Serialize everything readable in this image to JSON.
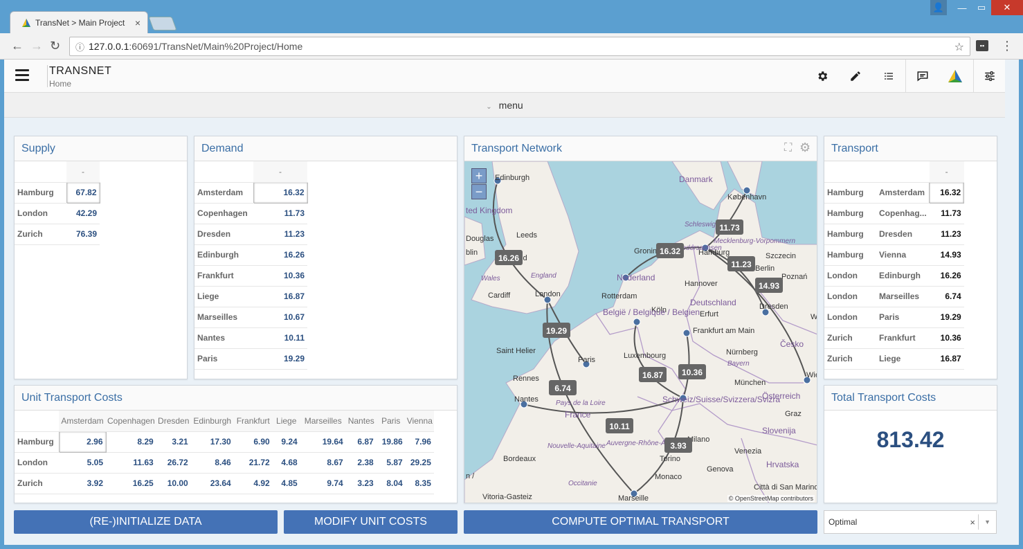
{
  "browser": {
    "tab_title": "TransNet > Main Project",
    "url_host": "127.0.0.1",
    "url_path": ":60691/TransNet/Main%20Project/Home"
  },
  "header": {
    "title": "TRANSNET",
    "subtitle": "Home",
    "icons": [
      "gear-icon",
      "pencil-icon",
      "list-icon",
      "chat-icon",
      "logo-icon",
      "sliders-icon"
    ]
  },
  "menu": {
    "label": "menu"
  },
  "supply": {
    "title": "Supply",
    "col_header": "-",
    "rows": [
      {
        "name": "Hamburg",
        "value": "67.82"
      },
      {
        "name": "London",
        "value": "42.29"
      },
      {
        "name": "Zurich",
        "value": "76.39"
      }
    ]
  },
  "demand": {
    "title": "Demand",
    "col_header": "-",
    "rows": [
      {
        "name": "Amsterdam",
        "value": "16.32"
      },
      {
        "name": "Copenhagen",
        "value": "11.73"
      },
      {
        "name": "Dresden",
        "value": "11.23"
      },
      {
        "name": "Edinburgh",
        "value": "16.26"
      },
      {
        "name": "Frankfurt",
        "value": "10.36"
      },
      {
        "name": "Liege",
        "value": "16.87"
      },
      {
        "name": "Marseilles",
        "value": "10.67"
      },
      {
        "name": "Nantes",
        "value": "10.11"
      },
      {
        "name": "Paris",
        "value": "19.29"
      }
    ]
  },
  "network": {
    "title": "Transport Network",
    "zoom_in": "+",
    "zoom_out": "−",
    "attribution": "© OpenStreetMap contributors",
    "place_labels": [
      {
        "text": "Danmark",
        "cls": "country"
      },
      {
        "text": "København",
        "cls": "city"
      },
      {
        "text": "Edinburgh",
        "cls": "city"
      },
      {
        "text": "ted Kingdom",
        "cls": "country"
      },
      {
        "text": "Leeds",
        "cls": "city"
      },
      {
        "text": "Douglas",
        "cls": "city"
      },
      {
        "text": "blin",
        "cls": "city"
      },
      {
        "text": "Sheffield",
        "cls": "city"
      },
      {
        "text": "England",
        "cls": "region"
      },
      {
        "text": "Wales",
        "cls": "region"
      },
      {
        "text": "Cardiff",
        "cls": "city"
      },
      {
        "text": "London",
        "cls": "city"
      },
      {
        "text": "Rotterdam",
        "cls": "city"
      },
      {
        "text": "Nederland",
        "cls": "country"
      },
      {
        "text": "Groningen",
        "cls": "city"
      },
      {
        "text": "Hamburg",
        "cls": "city"
      },
      {
        "text": "Schleswig-Holstein",
        "cls": "region"
      },
      {
        "text": "Mecklenburg-Vorpommern",
        "cls": "region"
      },
      {
        "text": "Szczecin",
        "cls": "city"
      },
      {
        "text": "Niedersachsen",
        "cls": "region"
      },
      {
        "text": "Berlin",
        "cls": "city"
      },
      {
        "text": "Hannover",
        "cls": "city"
      },
      {
        "text": "Poznań",
        "cls": "city"
      },
      {
        "text": "Deutschland",
        "cls": "country"
      },
      {
        "text": "Köln",
        "cls": "city"
      },
      {
        "text": "België / Belgique / Belgien",
        "cls": "country"
      },
      {
        "text": "Erfurt",
        "cls": "city"
      },
      {
        "text": "Dresden",
        "cls": "city"
      },
      {
        "text": "Wro",
        "cls": "city"
      },
      {
        "text": "Frankfurt am Main",
        "cls": "city"
      },
      {
        "text": "Česko",
        "cls": "country"
      },
      {
        "text": "Saint Helier",
        "cls": "city"
      },
      {
        "text": "Paris",
        "cls": "city"
      },
      {
        "text": "Luxembourg",
        "cls": "city"
      },
      {
        "text": "Nürnberg",
        "cls": "city"
      },
      {
        "text": "Bayern",
        "cls": "region"
      },
      {
        "text": "Rennes",
        "cls": "city"
      },
      {
        "text": "München",
        "cls": "city"
      },
      {
        "text": "Wien",
        "cls": "city"
      },
      {
        "text": "Nantes",
        "cls": "city"
      },
      {
        "text": "Pays de la Loire",
        "cls": "region"
      },
      {
        "text": "France",
        "cls": "country"
      },
      {
        "text": "Schweiz/Suisse/Svizzera/Svizra",
        "cls": "country"
      },
      {
        "text": "Österreich",
        "cls": "country"
      },
      {
        "text": "Graz",
        "cls": "city"
      },
      {
        "text": "Nouvelle-Aquitaine",
        "cls": "region"
      },
      {
        "text": "Auvergne-Rhône-Alpes",
        "cls": "region"
      },
      {
        "text": "Milano",
        "cls": "city"
      },
      {
        "text": "Slovenija",
        "cls": "country"
      },
      {
        "text": "Bordeaux",
        "cls": "city"
      },
      {
        "text": "Venezia",
        "cls": "city"
      },
      {
        "text": "Hrvatska",
        "cls": "country"
      },
      {
        "text": "Torino",
        "cls": "city"
      },
      {
        "text": "Genova",
        "cls": "city"
      },
      {
        "text": "Monaco",
        "cls": "city"
      },
      {
        "text": "Occitanie",
        "cls": "region"
      },
      {
        "text": "Città di San Marino",
        "cls": "city"
      },
      {
        "text": "Vitoria-Gasteiz",
        "cls": "city"
      },
      {
        "text": "Marseille",
        "cls": "city"
      },
      {
        "text": "n /",
        "cls": "city"
      }
    ],
    "flow_labels": [
      "11.73",
      "16.32",
      "11.23",
      "14.93",
      "16.26",
      "19.29",
      "16.87",
      "10.36",
      "6.74",
      "10.11",
      "3.93"
    ]
  },
  "transport": {
    "title": "Transport",
    "col_header": "-",
    "rows": [
      {
        "from": "Hamburg",
        "to": "Amsterdam",
        "value": "16.32"
      },
      {
        "from": "Hamburg",
        "to": "Copenhag...",
        "value": "11.73"
      },
      {
        "from": "Hamburg",
        "to": "Dresden",
        "value": "11.23"
      },
      {
        "from": "Hamburg",
        "to": "Vienna",
        "value": "14.93"
      },
      {
        "from": "London",
        "to": "Edinburgh",
        "value": "16.26"
      },
      {
        "from": "London",
        "to": "Marseilles",
        "value": "6.74"
      },
      {
        "from": "London",
        "to": "Paris",
        "value": "19.29"
      },
      {
        "from": "Zurich",
        "to": "Frankfurt",
        "value": "10.36"
      },
      {
        "from": "Zurich",
        "to": "Liege",
        "value": "16.87"
      }
    ]
  },
  "unit_costs": {
    "title": "Unit Transport Costs",
    "columns": [
      "Amsterdam",
      "Copenhagen",
      "Dresden",
      "Edinburgh",
      "Frankfurt",
      "Liege",
      "Marseilles",
      "Nantes",
      "Paris",
      "Vienna"
    ],
    "rows": [
      {
        "name": "Hamburg",
        "values": [
          "2.96",
          "8.29",
          "3.21",
          "17.30",
          "6.90",
          "9.24",
          "19.64",
          "6.87",
          "19.86",
          "7.96"
        ]
      },
      {
        "name": "London",
        "values": [
          "5.05",
          "11.63",
          "26.72",
          "8.46",
          "21.72",
          "4.68",
          "8.67",
          "2.38",
          "5.87",
          "29.25"
        ]
      },
      {
        "name": "Zurich",
        "values": [
          "3.92",
          "16.25",
          "10.00",
          "23.64",
          "4.92",
          "4.85",
          "9.74",
          "3.23",
          "8.04",
          "8.35"
        ]
      }
    ]
  },
  "total": {
    "title": "Total Transport Costs",
    "value": "813.42"
  },
  "buttons": {
    "init": "(RE-)INITIALIZE DATA",
    "modify": "MODIFY UNIT COSTS",
    "compute": "COMPUTE OPTIMAL TRANSPORT"
  },
  "status_select": {
    "value": "Optimal",
    "clear": "×",
    "arrow": "▼"
  }
}
